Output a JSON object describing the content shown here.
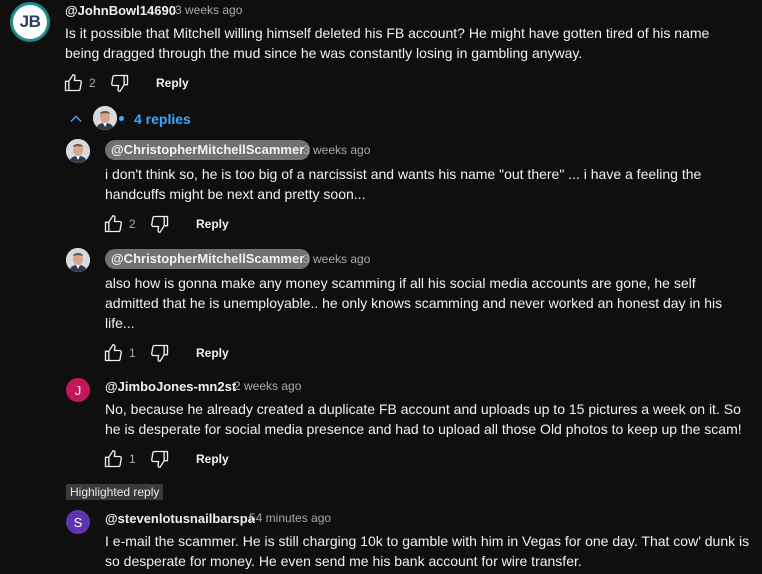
{
  "top_comment": {
    "avatar_initials": "JB",
    "author": "@JohnBowl14690",
    "time": "3 weeks ago",
    "text": "Is it possible that Mitchell willing himself deleted his FB account?  He might have gotten tired of his name being dragged through the mud since he was constantly losing in gambling anyway.",
    "likes": "2",
    "reply_label": "Reply"
  },
  "replies_toggle": {
    "label": "4 replies"
  },
  "replies": [
    {
      "author": "@ChristopherMitchellScammer",
      "time": "3 weeks ago",
      "text": "i don't think so, he is too big of a narcissist and wants his name \"out there\" ... i have a feeling the handcuffs might be next and pretty soon...",
      "likes": "2",
      "reply_label": "Reply"
    },
    {
      "author": "@ChristopherMitchellScammer",
      "time": "3 weeks ago",
      "text": "also how is gonna make any money scamming if all his social media accounts are gone, he self admitted that he is unemployable.. he only knows scamming and never worked an honest day in his life...",
      "likes": "1",
      "reply_label": "Reply"
    },
    {
      "avatar_letter": "J",
      "avatar_color": "#c2185b",
      "author": "@JimboJones-mn2st",
      "time": "2 weeks ago",
      "text": "No, because he already created a duplicate FB account and uploads up to 15 pictures a week on it. So he is desperate for social media presence and had to upload all those Old photos to keep up the scam!",
      "likes": "1",
      "reply_label": "Reply"
    }
  ],
  "highlighted": {
    "badge": "Highlighted reply",
    "avatar_letter": "S",
    "avatar_color": "#5e35b1",
    "author": "@stevenlotusnailbarspa",
    "time": "54 minutes ago",
    "text": "I e-mail the scammer. He is still charging 10k to gamble with him in Vegas for one day. That cow' dunk is so desperate for money. He even send me his bank account for wire transfer."
  },
  "colors": {
    "background": "#0f0f0f",
    "link": "#3ea6ff",
    "secondary_text": "#aaaaaa",
    "pill": "#717171"
  },
  "icons": {
    "like": "thumbs-up-icon",
    "dislike": "thumbs-down-icon",
    "collapse": "chevron-up-icon"
  }
}
